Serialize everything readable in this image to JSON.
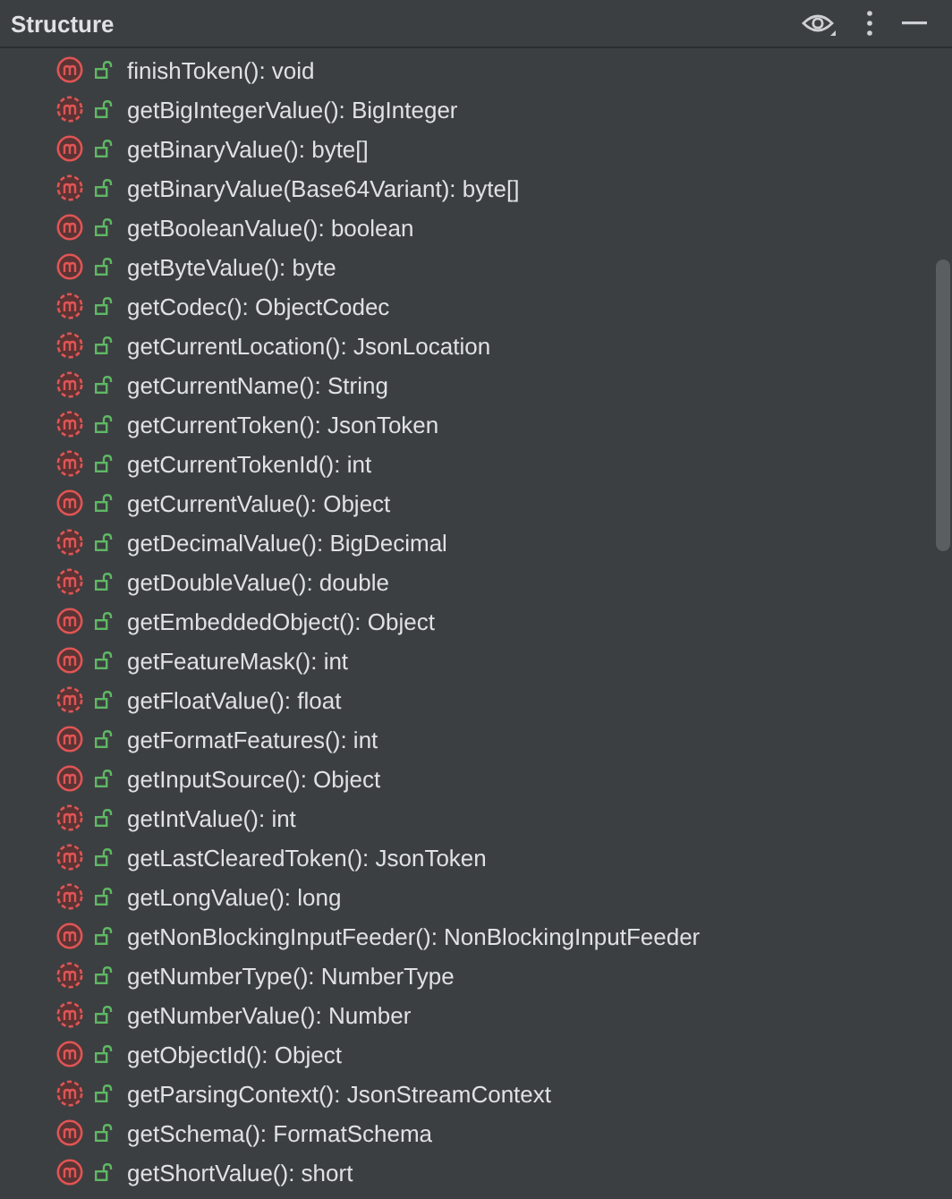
{
  "panel": {
    "title": "Structure"
  },
  "items": [
    {
      "label": "finishToken(): void",
      "abstract": false
    },
    {
      "label": "getBigIntegerValue(): BigInteger",
      "abstract": true
    },
    {
      "label": "getBinaryValue(): byte[]",
      "abstract": false
    },
    {
      "label": "getBinaryValue(Base64Variant): byte[]",
      "abstract": true
    },
    {
      "label": "getBooleanValue(): boolean",
      "abstract": false
    },
    {
      "label": "getByteValue(): byte",
      "abstract": false
    },
    {
      "label": "getCodec(): ObjectCodec",
      "abstract": true
    },
    {
      "label": "getCurrentLocation(): JsonLocation",
      "abstract": true
    },
    {
      "label": "getCurrentName(): String",
      "abstract": true
    },
    {
      "label": "getCurrentToken(): JsonToken",
      "abstract": true
    },
    {
      "label": "getCurrentTokenId(): int",
      "abstract": true
    },
    {
      "label": "getCurrentValue(): Object",
      "abstract": false
    },
    {
      "label": "getDecimalValue(): BigDecimal",
      "abstract": true
    },
    {
      "label": "getDoubleValue(): double",
      "abstract": true
    },
    {
      "label": "getEmbeddedObject(): Object",
      "abstract": false
    },
    {
      "label": "getFeatureMask(): int",
      "abstract": false
    },
    {
      "label": "getFloatValue(): float",
      "abstract": true
    },
    {
      "label": "getFormatFeatures(): int",
      "abstract": false
    },
    {
      "label": "getInputSource(): Object",
      "abstract": false
    },
    {
      "label": "getIntValue(): int",
      "abstract": true
    },
    {
      "label": "getLastClearedToken(): JsonToken",
      "abstract": true
    },
    {
      "label": "getLongValue(): long",
      "abstract": true
    },
    {
      "label": "getNonBlockingInputFeeder(): NonBlockingInputFeeder",
      "abstract": false
    },
    {
      "label": "getNumberType(): NumberType",
      "abstract": true
    },
    {
      "label": "getNumberValue(): Number",
      "abstract": true
    },
    {
      "label": "getObjectId(): Object",
      "abstract": false
    },
    {
      "label": "getParsingContext(): JsonStreamContext",
      "abstract": true
    },
    {
      "label": "getSchema(): FormatSchema",
      "abstract": false
    },
    {
      "label": "getShortValue(): short",
      "abstract": false
    }
  ]
}
